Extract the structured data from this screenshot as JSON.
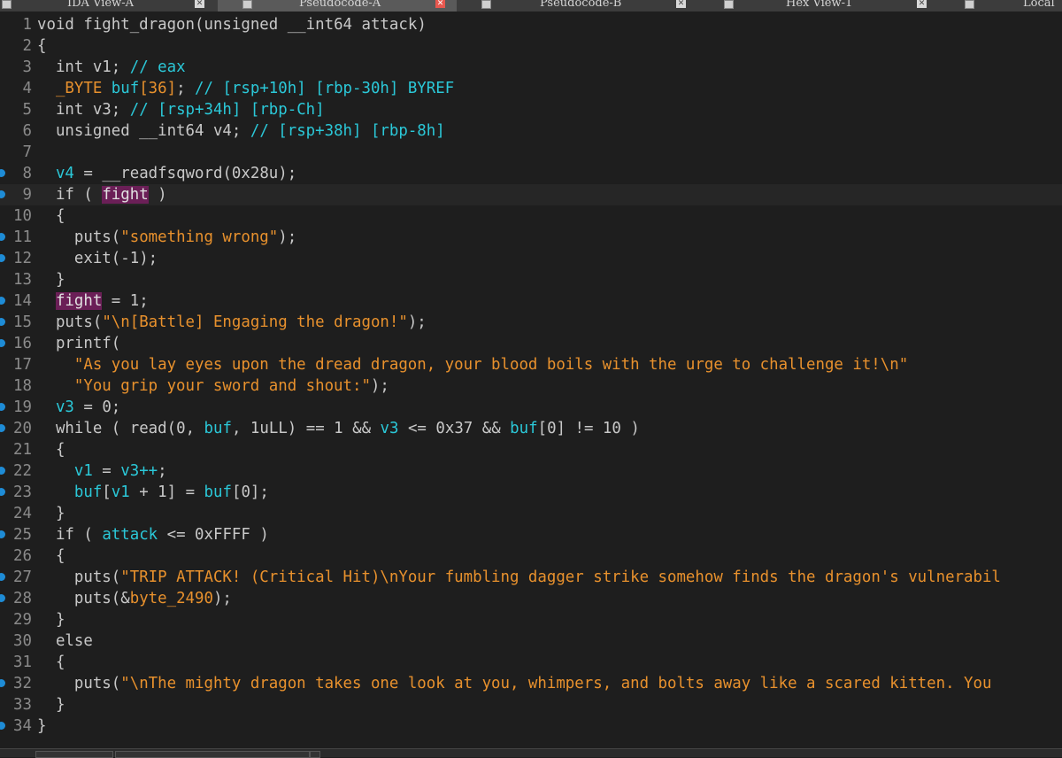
{
  "tabs": [
    {
      "label": "IDA View-A",
      "active": false
    },
    {
      "label": "Pseudocode-A",
      "active": true
    },
    {
      "label": "Pseudocode-B",
      "active": false
    },
    {
      "label": "Hex View-1",
      "active": false
    },
    {
      "label": "Local",
      "active": false
    }
  ],
  "colors": {
    "background": "#1e1e1e",
    "identifier": "#2bc8d8",
    "string": "#e8912d",
    "global_highlight": "#6b1f57",
    "breakpoint": "#1e8cd6",
    "active_tab_close": "#e8584f"
  },
  "lines": [
    {
      "n": "1",
      "bp": false,
      "current": false,
      "tokens": [
        [
          "kw",
          "void "
        ],
        [
          "fn",
          "fight_dragon"
        ],
        [
          "bra",
          "("
        ],
        [
          "kw",
          "unsigned __int64 "
        ],
        [
          "kw",
          "attack"
        ],
        [
          "bra",
          ")"
        ]
      ]
    },
    {
      "n": "2",
      "bp": false,
      "current": false,
      "tokens": [
        [
          "bra",
          "{"
        ]
      ]
    },
    {
      "n": "3",
      "bp": false,
      "current": false,
      "tokens": [
        [
          "kw",
          "  int "
        ],
        [
          "kw",
          "v1"
        ],
        [
          "bra",
          "; "
        ],
        [
          "cmt",
          "// eax"
        ]
      ]
    },
    {
      "n": "4",
      "bp": false,
      "current": false,
      "tokens": [
        [
          "str",
          "  _BYTE "
        ],
        [
          "var",
          "buf"
        ],
        [
          "str",
          "[36]"
        ],
        [
          "bra",
          "; "
        ],
        [
          "cmt",
          "// [rsp+10h] [rbp-30h] BYREF"
        ]
      ]
    },
    {
      "n": "5",
      "bp": false,
      "current": false,
      "tokens": [
        [
          "kw",
          "  int "
        ],
        [
          "kw",
          "v3"
        ],
        [
          "bra",
          "; "
        ],
        [
          "cmt",
          "// [rsp+34h] [rbp-Ch]"
        ]
      ]
    },
    {
      "n": "6",
      "bp": false,
      "current": false,
      "tokens": [
        [
          "kw",
          "  unsigned __int64 "
        ],
        [
          "kw",
          "v4"
        ],
        [
          "bra",
          "; "
        ],
        [
          "cmt",
          "// [rsp+38h] [rbp-8h]"
        ]
      ]
    },
    {
      "n": "7",
      "bp": false,
      "current": false,
      "tokens": []
    },
    {
      "n": "8",
      "bp": true,
      "current": false,
      "tokens": [
        [
          "var",
          "  v4"
        ],
        [
          "bra",
          " = "
        ],
        [
          "fn",
          "__readfsqword"
        ],
        [
          "bra",
          "("
        ],
        [
          "num",
          "0x28u"
        ],
        [
          "bra",
          ");"
        ]
      ]
    },
    {
      "n": "9",
      "bp": true,
      "current": true,
      "tokens": [
        [
          "kw",
          "  if"
        ],
        [
          "bra",
          " ( "
        ],
        [
          "glb",
          "fight"
        ],
        [
          "bra",
          " )"
        ]
      ]
    },
    {
      "n": "10",
      "bp": false,
      "current": false,
      "tokens": [
        [
          "bra",
          "  {"
        ]
      ]
    },
    {
      "n": "11",
      "bp": true,
      "current": false,
      "tokens": [
        [
          "fn",
          "    puts"
        ],
        [
          "bra",
          "("
        ],
        [
          "str",
          "\"something wrong\""
        ],
        [
          "bra",
          ");"
        ]
      ]
    },
    {
      "n": "12",
      "bp": true,
      "current": false,
      "tokens": [
        [
          "fn",
          "    exit"
        ],
        [
          "bra",
          "("
        ],
        [
          "num",
          "-1"
        ],
        [
          "bra",
          ");"
        ]
      ]
    },
    {
      "n": "13",
      "bp": false,
      "current": false,
      "tokens": [
        [
          "bra",
          "  }"
        ]
      ]
    },
    {
      "n": "14",
      "bp": true,
      "current": false,
      "tokens": [
        [
          "kw",
          "  "
        ],
        [
          "glb",
          "fight"
        ],
        [
          "bra",
          " = "
        ],
        [
          "num",
          "1"
        ],
        [
          "bra",
          ";"
        ]
      ]
    },
    {
      "n": "15",
      "bp": true,
      "current": false,
      "tokens": [
        [
          "fn",
          "  puts"
        ],
        [
          "bra",
          "("
        ],
        [
          "str",
          "\"\\n[Battle] Engaging the dragon!\""
        ],
        [
          "bra",
          ");"
        ]
      ]
    },
    {
      "n": "16",
      "bp": true,
      "current": false,
      "tokens": [
        [
          "fn",
          "  printf"
        ],
        [
          "bra",
          "("
        ]
      ]
    },
    {
      "n": "17",
      "bp": false,
      "current": false,
      "tokens": [
        [
          "str",
          "    \"As you lay eyes upon the dread dragon, your blood boils with the urge to challenge it!\\n\""
        ]
      ]
    },
    {
      "n": "18",
      "bp": false,
      "current": false,
      "tokens": [
        [
          "str",
          "    \"You grip your sword and shout:\""
        ],
        [
          "bra",
          ");"
        ]
      ]
    },
    {
      "n": "19",
      "bp": true,
      "current": false,
      "tokens": [
        [
          "var",
          "  v3"
        ],
        [
          "bra",
          " = "
        ],
        [
          "num",
          "0"
        ],
        [
          "bra",
          ";"
        ]
      ]
    },
    {
      "n": "20",
      "bp": true,
      "current": false,
      "tokens": [
        [
          "kw",
          "  while"
        ],
        [
          "bra",
          " ( "
        ],
        [
          "fn",
          "read"
        ],
        [
          "bra",
          "("
        ],
        [
          "num",
          "0"
        ],
        [
          "bra",
          ", "
        ],
        [
          "var",
          "buf"
        ],
        [
          "bra",
          ", "
        ],
        [
          "num",
          "1uLL"
        ],
        [
          "bra",
          ") == "
        ],
        [
          "num",
          "1"
        ],
        [
          "bra",
          " && "
        ],
        [
          "var",
          "v3"
        ],
        [
          "bra",
          " <= "
        ],
        [
          "num",
          "0x37"
        ],
        [
          "bra",
          " && "
        ],
        [
          "var",
          "buf"
        ],
        [
          "bra",
          "["
        ],
        [
          "num",
          "0"
        ],
        [
          "bra",
          "] != "
        ],
        [
          "num",
          "10"
        ],
        [
          "bra",
          " )"
        ]
      ]
    },
    {
      "n": "21",
      "bp": false,
      "current": false,
      "tokens": [
        [
          "bra",
          "  {"
        ]
      ]
    },
    {
      "n": "22",
      "bp": true,
      "current": false,
      "tokens": [
        [
          "var",
          "    v1"
        ],
        [
          "bra",
          " = "
        ],
        [
          "var",
          "v3++"
        ],
        [
          "bra",
          ";"
        ]
      ]
    },
    {
      "n": "23",
      "bp": true,
      "current": false,
      "tokens": [
        [
          "var",
          "    buf"
        ],
        [
          "bra",
          "["
        ],
        [
          "var",
          "v1"
        ],
        [
          "bra",
          " + "
        ],
        [
          "num",
          "1"
        ],
        [
          "bra",
          "] = "
        ],
        [
          "var",
          "buf"
        ],
        [
          "bra",
          "["
        ],
        [
          "num",
          "0"
        ],
        [
          "bra",
          "];"
        ]
      ]
    },
    {
      "n": "24",
      "bp": false,
      "current": false,
      "tokens": [
        [
          "bra",
          "  }"
        ]
      ]
    },
    {
      "n": "25",
      "bp": true,
      "current": false,
      "tokens": [
        [
          "kw",
          "  if"
        ],
        [
          "bra",
          " ( "
        ],
        [
          "var",
          "attack"
        ],
        [
          "bra",
          " <= "
        ],
        [
          "num",
          "0xFFFF"
        ],
        [
          "bra",
          " )"
        ]
      ]
    },
    {
      "n": "26",
      "bp": false,
      "current": false,
      "tokens": [
        [
          "bra",
          "  {"
        ]
      ]
    },
    {
      "n": "27",
      "bp": true,
      "current": false,
      "tokens": [
        [
          "fn",
          "    puts"
        ],
        [
          "bra",
          "("
        ],
        [
          "str",
          "\"TRIP ATTACK! (Critical Hit)\\nYour fumbling dagger strike somehow finds the dragon's vulnerabil"
        ]
      ]
    },
    {
      "n": "28",
      "bp": true,
      "current": false,
      "tokens": [
        [
          "fn",
          "    puts"
        ],
        [
          "bra",
          "(&"
        ],
        [
          "str",
          "byte_2490"
        ],
        [
          "bra",
          ");"
        ]
      ]
    },
    {
      "n": "29",
      "bp": false,
      "current": false,
      "tokens": [
        [
          "bra",
          "  }"
        ]
      ]
    },
    {
      "n": "30",
      "bp": false,
      "current": false,
      "tokens": [
        [
          "kw",
          "  else"
        ]
      ]
    },
    {
      "n": "31",
      "bp": false,
      "current": false,
      "tokens": [
        [
          "bra",
          "  {"
        ]
      ]
    },
    {
      "n": "32",
      "bp": true,
      "current": false,
      "tokens": [
        [
          "fn",
          "    puts"
        ],
        [
          "bra",
          "("
        ],
        [
          "str",
          "\"\\nThe mighty dragon takes one look at you, whimpers, and bolts away like a scared kitten. You"
        ]
      ]
    },
    {
      "n": "33",
      "bp": false,
      "current": false,
      "tokens": [
        [
          "bra",
          "  }"
        ]
      ]
    },
    {
      "n": "34",
      "bp": true,
      "current": false,
      "tokens": [
        [
          "bra",
          "}"
        ]
      ]
    }
  ]
}
